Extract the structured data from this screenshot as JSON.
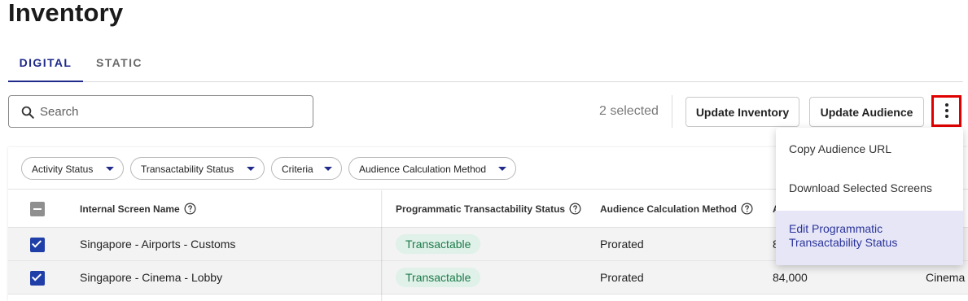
{
  "page": {
    "title": "Inventory"
  },
  "tabs": [
    {
      "label": "DIGITAL",
      "active": true
    },
    {
      "label": "STATIC",
      "active": false
    }
  ],
  "search": {
    "placeholder": "Search",
    "value": ""
  },
  "toolbar": {
    "selected_count": "2 selected",
    "update_inventory_label": "Update Inventory",
    "update_audience_label": "Update Audience",
    "more_icon": "more-vertical-icon"
  },
  "filters": [
    {
      "label": "Activity Status"
    },
    {
      "label": "Transactability Status"
    },
    {
      "label": "Criteria"
    },
    {
      "label": "Audience Calculation Method"
    }
  ],
  "table": {
    "columns": [
      {
        "label": "Internal Screen Name",
        "help": true
      },
      {
        "label": "Programmatic Transactability Status",
        "help": true
      },
      {
        "label": "Audience Calculation Method",
        "help": true
      },
      {
        "label": "A",
        "help": false
      }
    ],
    "rows": [
      {
        "selected": true,
        "name": "Singapore - Airports - Customs",
        "status": "Transactable",
        "method": "Prorated",
        "audience": "8",
        "extra": ""
      },
      {
        "selected": true,
        "name": "Singapore - Cinema - Lobby",
        "status": "Transactable",
        "method": "Prorated",
        "audience": "84,000",
        "extra": "Cinema"
      }
    ]
  },
  "menu": {
    "items": [
      {
        "label": "Copy Audience URL",
        "highlighted": false
      },
      {
        "label": "Download Selected Screens",
        "highlighted": false
      },
      {
        "label": "Edit Programmatic Transactability Status",
        "highlighted": true
      }
    ]
  },
  "colors": {
    "accent": "#1f2a8a",
    "checkbox": "#1f3ea8",
    "pill_bg": "#dff1e8",
    "pill_text": "#1d7a4a",
    "menu_highlight": "#e6e6f7",
    "kebab_outline": "#e00000"
  }
}
